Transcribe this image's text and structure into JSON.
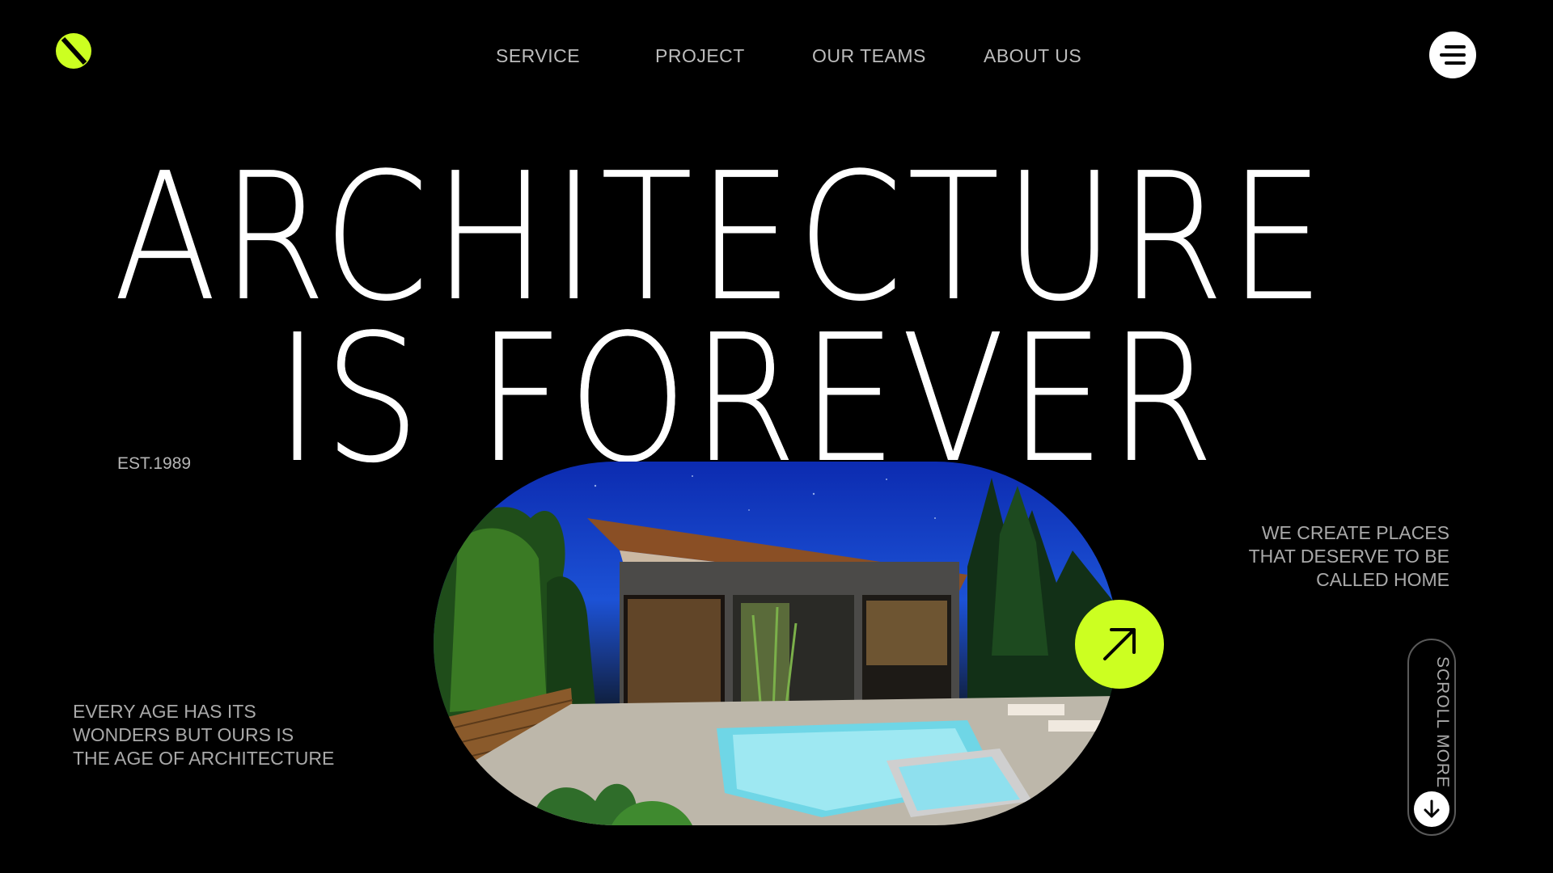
{
  "header": {
    "logo_icon": "slashed-circle-logo",
    "nav": [
      {
        "label": "SERVICE"
      },
      {
        "label": "PROJECT"
      },
      {
        "label": "OUR TEAMS"
      },
      {
        "label": "ABOUT US"
      }
    ],
    "menu_icon": "hamburger-menu-icon"
  },
  "hero": {
    "headline_line1": "ARCHITECTURE",
    "headline_line2": "IS FOREVER",
    "established": "EST.1989",
    "tagline_right": [
      "WE CREATE PLACES",
      "THAT DESERVE TO BE",
      "CALLED HOME"
    ],
    "tagline_left": [
      "EVERY AGE HAS ITS",
      "WONDERS BUT OURS IS",
      "THE AGE OF ARCHITECTURE"
    ],
    "image_alt": "modern house with pool at night",
    "arrow_icon": "arrow-up-right-icon",
    "scroll_label": "SCROLL MORE",
    "scroll_icon": "arrow-down-icon"
  },
  "colors": {
    "background": "#000000",
    "accent": "#ccff21",
    "text_muted": "#a9a9a9"
  }
}
